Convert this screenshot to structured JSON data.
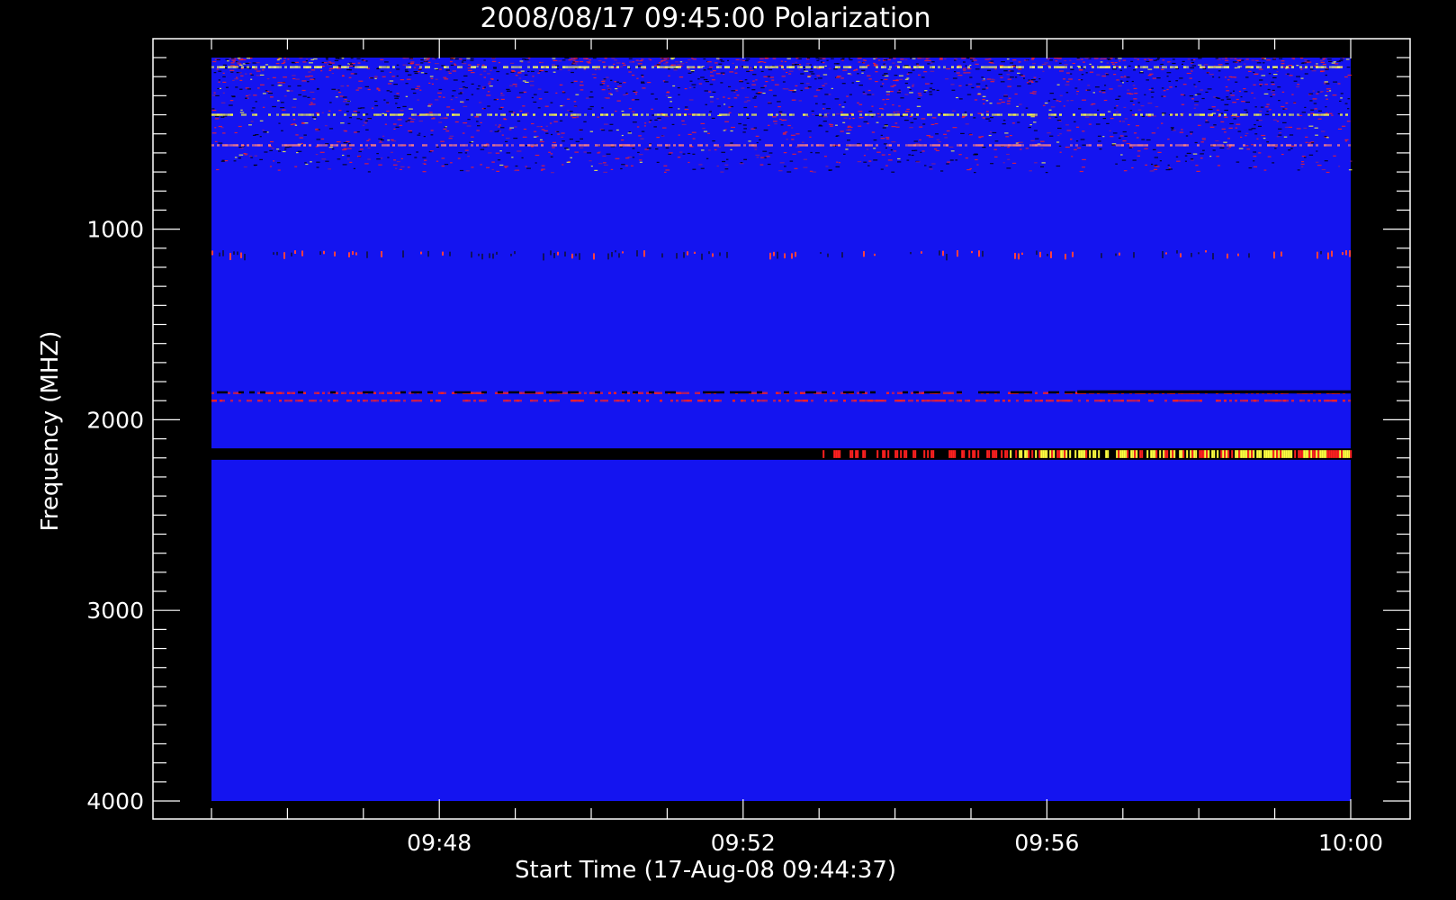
{
  "chart_data": {
    "type": "heatmap",
    "title": "2008/08/17 09:45:00 Polarization",
    "xlabel": "Start Time (17-Aug-08 09:44:37)",
    "ylabel": "Frequency (MHZ)",
    "x_ticks": [
      "09:48",
      "09:52",
      "09:56",
      "10:00"
    ],
    "y_ticks": [
      "1000",
      "2000",
      "3000",
      "4000"
    ],
    "x_range_minutes": [
      0,
      15
    ],
    "y_range_mhz": [
      100,
      4000
    ],
    "y_axis_inverted": true,
    "background_color": "#1414f0",
    "colormap": [
      "#000000",
      "#2020ff",
      "#ff2020",
      "#ffff40",
      "#ffffff"
    ],
    "features": [
      {
        "type": "noisy_band",
        "y0": 100,
        "y1": 700,
        "intensity": 0.5
      },
      {
        "type": "line",
        "y": 150,
        "color": "#ffff60"
      },
      {
        "type": "line",
        "y": 400,
        "color": "#ffff40"
      },
      {
        "type": "line",
        "y": 560,
        "color": "#ff8080"
      },
      {
        "type": "dotted_line",
        "y": 1120,
        "color": "#ff4040"
      },
      {
        "type": "line",
        "y": 1860,
        "color": "#ff2020"
      },
      {
        "type": "line",
        "y": 1900,
        "color": "#ff2020"
      },
      {
        "type": "dark_line",
        "y": 1855,
        "color": "#000000"
      },
      {
        "type": "dark_band",
        "y0": 2150,
        "y1": 2210,
        "color": "#000000"
      },
      {
        "type": "bright_band",
        "y0": 2150,
        "y1": 2210,
        "x_start_minute": 10,
        "color": "#ffff40"
      }
    ]
  }
}
